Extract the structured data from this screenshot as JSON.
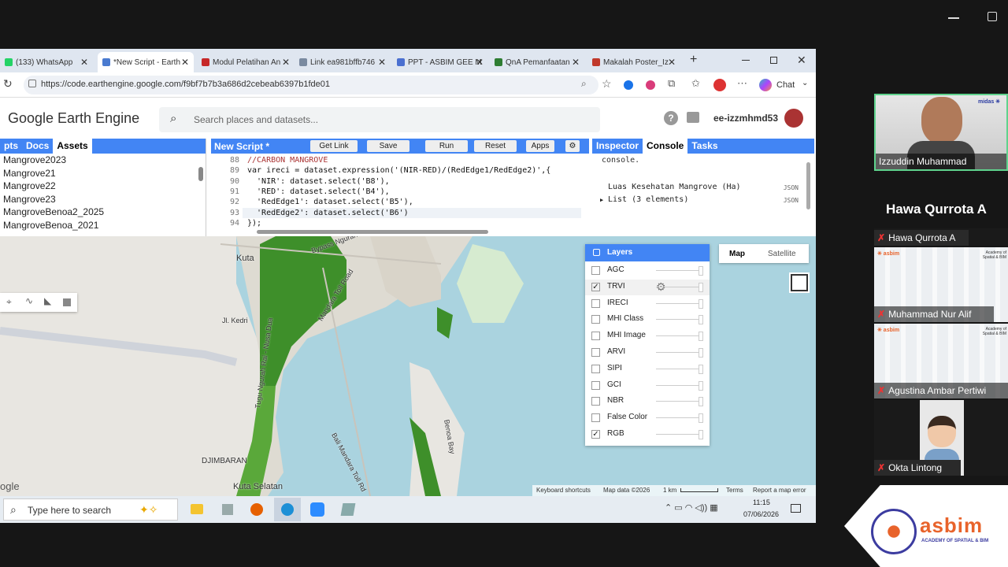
{
  "meet": {
    "minimize_icon": "minimize-icon",
    "restore_icon": "restore-icon"
  },
  "browser": {
    "tabs": [
      {
        "label": "(133) WhatsApp",
        "icon": "whatsapp-icon",
        "color": "#25d366"
      },
      {
        "label": "*New Script - Earth",
        "icon": "earth-engine-icon",
        "color": "#4a7bd0"
      },
      {
        "label": "Modul Pelatihan An",
        "icon": "pdf-icon",
        "color": "#c62828"
      },
      {
        "label": "Link ea981bffb746",
        "icon": "link-icon",
        "color": "#7a8aa0"
      },
      {
        "label": "PPT - ASBIM GEE M",
        "icon": "slides-icon",
        "color": "#4a6fd0"
      },
      {
        "label": "QnA Pemanfaatan",
        "icon": "sheet-icon",
        "color": "#2e7d32"
      },
      {
        "label": "Makalah Poster_Iz",
        "icon": "doc-icon",
        "color": "#c0392b"
      }
    ],
    "url": "https://code.earthengine.google.com/f9bf7b7b3a686d2cebeab6397b1fde01",
    "chat_label": "Chat"
  },
  "gee": {
    "logo": "Google Earth Engine",
    "search_placeholder": "Search places and datasets...",
    "user": "ee-izzmhmd53",
    "left_tabs": [
      "pts",
      "Docs",
      "Assets"
    ],
    "assets": [
      "Mangrove2023",
      "Mangrove21",
      "Mangrove22",
      "Mangrove23",
      "MangroveBenoa2_2025",
      "MangroveBenoa_2021"
    ],
    "script_title": "New Script *",
    "buttons": {
      "get_link": "Get Link",
      "save": "Save",
      "run": "Run",
      "reset": "Reset",
      "apps": "Apps"
    },
    "code": [
      {
        "n": "88",
        "t": "//CARBON MANGROVE"
      },
      {
        "n": "89",
        "t": "var ireci = dataset.expression('(NIR-RED)/(RedEdge1/RedEdge2)',{"
      },
      {
        "n": "90",
        "t": "  'NIR': dataset.select('B8'),"
      },
      {
        "n": "91",
        "t": "  'RED': dataset.select('B4'),"
      },
      {
        "n": "92",
        "t": "  'RedEdge1': dataset.select('B5'),"
      },
      {
        "n": "93",
        "t": "  'RedEdge2': dataset.select('B6')"
      },
      {
        "n": "94",
        "t": "});"
      }
    ],
    "right_tabs": [
      "Inspector",
      "Console",
      "Tasks"
    ],
    "console_top": "console.",
    "console_lines": [
      {
        "text": "Luas Kesehatan Mangrove (Ha)",
        "tag": "JSON"
      },
      {
        "text": "List (3 elements)",
        "tag": "JSON"
      }
    ]
  },
  "map": {
    "place_labels": [
      "Kuta",
      "Bypass Ngurah",
      "Jl. Kedri",
      "Mandara Toll Road",
      "Tugu Ngurah Rai - Nusa Dua",
      "Bali Mandara Toll Rd",
      "DJIMBARAN",
      "Kuta Selatan",
      "Benoa Bay"
    ],
    "map_type": [
      "Map",
      "Satellite"
    ],
    "layers_title": "Layers",
    "layers": [
      {
        "name": "AGC",
        "checked": false
      },
      {
        "name": "TRVI",
        "checked": true
      },
      {
        "name": "IRECI",
        "checked": false
      },
      {
        "name": "MHI Class",
        "checked": false
      },
      {
        "name": "MHI Image",
        "checked": false
      },
      {
        "name": "ARVI",
        "checked": false
      },
      {
        "name": "SIPI",
        "checked": false
      },
      {
        "name": "GCI",
        "checked": false
      },
      {
        "name": "NBR",
        "checked": false
      },
      {
        "name": "False Color",
        "checked": false
      },
      {
        "name": "RGB",
        "checked": true
      }
    ],
    "footer": {
      "shortcuts": "Keyboard shortcuts",
      "data": "Map data ©2026",
      "scale": "1 km",
      "terms": "Terms",
      "report": "Report a map error"
    },
    "google_mark": "ogle"
  },
  "taskbar": {
    "search": "Type here to search",
    "time": "11:15",
    "date": "07/06/2026"
  },
  "participants": [
    {
      "name": "Izzuddin Muhammad",
      "type": "video"
    },
    {
      "name": "Hawa Qurrota A",
      "type": "audio"
    },
    {
      "name": "Muhammad Nur Alif",
      "type": "slide"
    },
    {
      "name": "Agustina Ambar Pertiwi",
      "type": "slide"
    },
    {
      "name": "Okta Lintong",
      "type": "avatar"
    }
  ],
  "big_name": "Hawa Qurrota A",
  "brand": {
    "name": "asbim",
    "tagline": "ACADEMY OF SPATIAL & BIM",
    "slide_brand": "Academy of Spatial & BIM"
  },
  "colors": {
    "accent": "#4285f4",
    "water": "#aad3df",
    "mangrove": "#2e8b1f",
    "brand": "#e8632b"
  }
}
